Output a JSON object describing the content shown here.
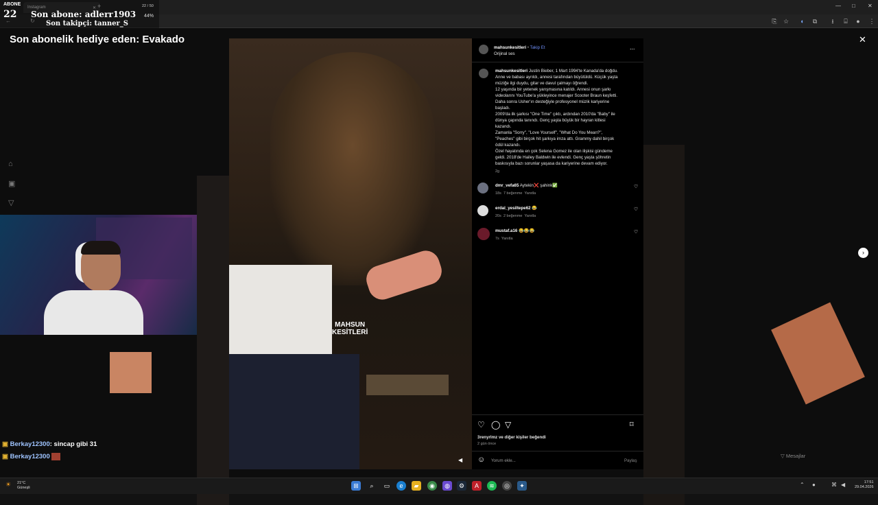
{
  "browser": {
    "tab_title": "Instagram",
    "tab_new": "+",
    "window_controls": [
      "—",
      "□",
      "✕"
    ]
  },
  "stream_overlay": {
    "sub_label": "ABONE",
    "sub_count": "22",
    "last_sub": "Son abone: adlerr1903",
    "last_follower": "Son takipçi: tanner_S",
    "volume_text": "22 / 50",
    "volume_pct": "44%",
    "gift_sub": "Son abonelik hediye eden: Evakado"
  },
  "post": {
    "username": "mahsunkesitleri",
    "follow": "Takip Et",
    "dot": "•",
    "audio": "Orijinal ses",
    "watermark_top": "MAHSUN",
    "watermark_bottom": "KESİTLERİ",
    "caption_lines": [
      "Justin Bieber, 1 Mart 1994'te Kanada'da doğdu.",
      "Anne ve babası ayrıldı, annesi tarafından büyütüldü. Küçük yaşta",
      "müziğe ilgi duydu, gitar ve davul çalmayı öğrendi.",
      "12 yaşında bir yetenek yarışmasına katıldı. Annesi onun şarkı",
      "videolarını YouTube'a yükleyince menajer Scooter Braun keşfetti.",
      "Daha sonra Usher'ın desteğiyle profesyonel müzik kariyerine",
      "başladı.",
      "2009'da ilk şarkısı \"One Time\" çıktı, ardından 2010'da \"Baby\" ile",
      "dünya çapında tanındı. Genç yaşta büyük bir hayran kitlesi",
      "kazandı.",
      "Zamanla \"Sorry\", \"Love Yourself\", \"What Do You Mean?\",",
      "\"Peaches\" gibi birçok hit şarkıya imza attı. Grammy dahil birçok",
      "ödül kazandı.",
      "Özel hayatında en çok Selena Gomez ile olan ilişkisi gündeme",
      "geldi. 2018'de Hailey Baldwin ile evlendi. Genç yaşta şöhretin",
      "baskısıyla bazı sorunlar yaşasa da kariyerine devam ediyor."
    ],
    "caption_time": "2g",
    "comments": [
      {
        "user": "dmr_vefa65",
        "text": "Aytekin❌ şahink✅",
        "time": "18s",
        "likes": "7 beğenme",
        "reply": "Yanıtla"
      },
      {
        "user": "erdal_yesiltepe62",
        "text": "😂",
        "time": "20s",
        "likes": "2 beğenme",
        "reply": "Yanıtla"
      },
      {
        "user": "mustaf.a16",
        "text": "😂😂😂",
        "time": "7s",
        "likes": "",
        "reply": "Yanıtla"
      }
    ],
    "liked_by": "3renyrlmz ve diğer kişiler beğendi",
    "posted": "2 gün önce",
    "comment_placeholder": "Yorum ekle...",
    "share": "Paylaş",
    "more": "..."
  },
  "side": {
    "messages": "Mesajlar"
  },
  "chat": [
    {
      "user": "Berkay12300",
      "text": ": sincap gibi 31"
    },
    {
      "user": "Berkay12300",
      "text": ""
    }
  ],
  "taskbar": {
    "weather_temp": "21°C",
    "weather_label": "Güneşli",
    "time": "17:51",
    "date": "29.04.2026"
  },
  "colors": {
    "accent_blue": "#6f8ff7",
    "chat_name": "#9fc4ff",
    "bg": "#121212"
  }
}
